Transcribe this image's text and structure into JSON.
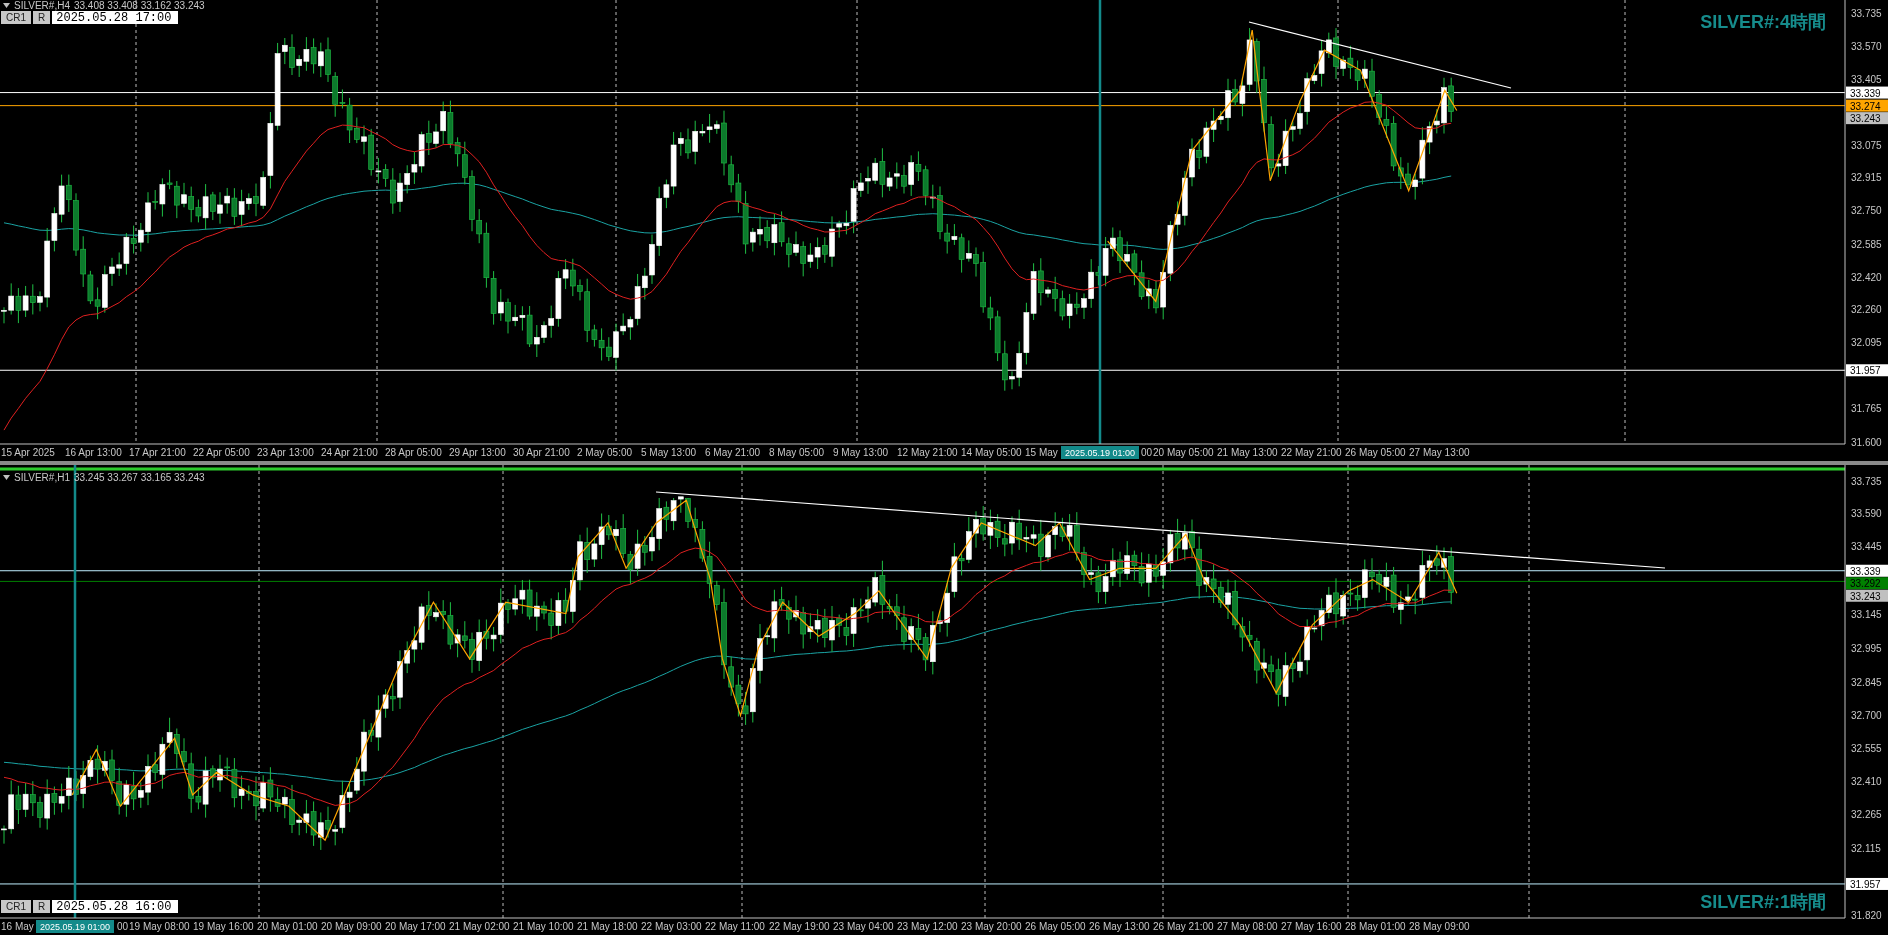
{
  "panels": [
    {
      "symbol": "SILVER#,H4",
      "ohlc": "33.408 33.408 33.162 33.243",
      "buttons": [
        "CR1",
        "R"
      ],
      "time": "2025.05.28 17:00",
      "label": "SILVER#:4時間",
      "y_ticks": [
        "33.735",
        "33.570",
        "33.405",
        "33.075",
        "32.915",
        "32.750",
        "32.585",
        "32.420",
        "32.260",
        "32.095",
        "31.765",
        "31.600"
      ],
      "price_tags": [
        {
          "value": "33.339",
          "kind": "level",
          "color": "#ffffff"
        },
        {
          "value": "33.274",
          "kind": "level",
          "color": "#ffa500"
        },
        {
          "value": "33.243",
          "kind": "bid",
          "color": "#c0c0c0"
        },
        {
          "value": "31.957",
          "kind": "level",
          "color": "#ffffff"
        }
      ],
      "x_labels": [
        {
          "text": "15 Apr 2025",
          "kind": "tick"
        },
        {
          "text": "16 Apr 13:00",
          "kind": "tick"
        },
        {
          "text": "17 Apr 21:00",
          "kind": "tick"
        },
        {
          "text": "22 Apr 05:00",
          "kind": "tick"
        },
        {
          "text": "23 Apr 13:00",
          "kind": "tick"
        },
        {
          "text": "24 Apr 21:00",
          "kind": "tick"
        },
        {
          "text": "28 Apr 05:00",
          "kind": "tick"
        },
        {
          "text": "29 Apr 13:00",
          "kind": "tick"
        },
        {
          "text": "30 Apr 21:00",
          "kind": "tick"
        },
        {
          "text": "2 May 05:00",
          "kind": "tick"
        },
        {
          "text": "5 May 13:00",
          "kind": "tick"
        },
        {
          "text": "6 May 21:00",
          "kind": "tick"
        },
        {
          "text": "8 May 05:00",
          "kind": "tick"
        },
        {
          "text": "9 May 13:00",
          "kind": "tick"
        },
        {
          "text": "12 May 21:00",
          "kind": "tick"
        },
        {
          "text": "14 May 05:00",
          "kind": "tick"
        },
        {
          "text": "15 May",
          "kind": "tick"
        },
        {
          "text": "2025.05.19 01:00",
          "kind": "cursor"
        },
        {
          "text": "00",
          "kind": "tail"
        },
        {
          "text": "20 May 05:00",
          "kind": "tick"
        },
        {
          "text": "21 May 13:00",
          "kind": "tick"
        },
        {
          "text": "22 May 21:00",
          "kind": "tick"
        },
        {
          "text": "26 May 05:00",
          "kind": "tick"
        },
        {
          "text": "27 May 13:00",
          "kind": "tick"
        }
      ]
    },
    {
      "symbol": "SILVER#,H1",
      "ohlc": "33.245 33.267 33.165 33.243",
      "buttons": [
        "CR1",
        "R"
      ],
      "time": "2025.05.28 16:00",
      "label": "SILVER#:1時間",
      "y_ticks": [
        "33.735",
        "33.590",
        "33.445",
        "33.145",
        "32.995",
        "32.845",
        "32.700",
        "32.555",
        "32.410",
        "32.265",
        "32.115",
        "31.820"
      ],
      "price_tags": [
        {
          "value": "33.339",
          "kind": "level",
          "color": "#ffffff"
        },
        {
          "value": "33.292",
          "kind": "level",
          "color": "#008000"
        },
        {
          "value": "33.243",
          "kind": "bid",
          "color": "#c0c0c0"
        },
        {
          "value": "31.957",
          "kind": "level",
          "color": "#ffffff"
        }
      ],
      "x_labels": [
        {
          "text": "16 May",
          "kind": "tick"
        },
        {
          "text": "2025.05.19 01:00",
          "kind": "cursor"
        },
        {
          "text": "00",
          "kind": "tail"
        },
        {
          "text": "19 May 08:00",
          "kind": "tick"
        },
        {
          "text": "19 May 16:00",
          "kind": "tick"
        },
        {
          "text": "20 May 01:00",
          "kind": "tick"
        },
        {
          "text": "20 May 09:00",
          "kind": "tick"
        },
        {
          "text": "20 May 17:00",
          "kind": "tick"
        },
        {
          "text": "21 May 02:00",
          "kind": "tick"
        },
        {
          "text": "21 May 10:00",
          "kind": "tick"
        },
        {
          "text": "21 May 18:00",
          "kind": "tick"
        },
        {
          "text": "22 May 03:00",
          "kind": "tick"
        },
        {
          "text": "22 May 11:00",
          "kind": "tick"
        },
        {
          "text": "22 May 19:00",
          "kind": "tick"
        },
        {
          "text": "23 May 04:00",
          "kind": "tick"
        },
        {
          "text": "23 May 12:00",
          "kind": "tick"
        },
        {
          "text": "23 May 20:00",
          "kind": "tick"
        },
        {
          "text": "26 May 05:00",
          "kind": "tick"
        },
        {
          "text": "26 May 13:00",
          "kind": "tick"
        },
        {
          "text": "26 May 21:00",
          "kind": "tick"
        },
        {
          "text": "27 May 08:00",
          "kind": "tick"
        },
        {
          "text": "27 May 16:00",
          "kind": "tick"
        },
        {
          "text": "28 May 01:00",
          "kind": "tick"
        },
        {
          "text": "28 May 09:00",
          "kind": "tick"
        }
      ]
    }
  ]
}
